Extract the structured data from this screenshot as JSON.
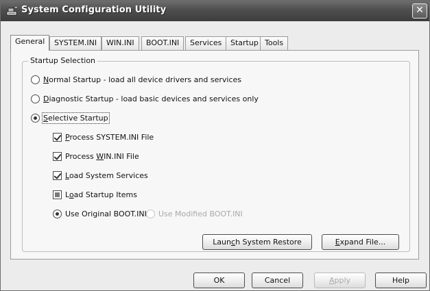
{
  "window": {
    "title": "System Configuration Utility",
    "close_glyph": "✕"
  },
  "tabs": [
    {
      "label": "General",
      "active": true
    },
    {
      "label": "SYSTEM.INI",
      "active": false
    },
    {
      "label": "WIN.INI",
      "active": false
    },
    {
      "label": "BOOT.INI",
      "active": false
    },
    {
      "label": "Services",
      "active": false
    },
    {
      "label": "Startup",
      "active": false
    },
    {
      "label": "Tools",
      "active": false
    }
  ],
  "startup_selection": {
    "legend": "Startup Selection",
    "normal": {
      "mnemonic": "N",
      "rest": "ormal Startup - load all device drivers and services",
      "checked": false
    },
    "diagnostic": {
      "mnemonic": "D",
      "rest": "iagnostic Startup - load basic devices and services only",
      "checked": false
    },
    "selective": {
      "mnemonic": "S",
      "rest": "elective Startup",
      "checked": true
    },
    "options": {
      "system_ini": {
        "pre": "",
        "mnemonic": "P",
        "rest": "rocess SYSTEM.INI File",
        "state": "checked"
      },
      "win_ini": {
        "pre": "Process ",
        "mnemonic": "W",
        "rest": "IN.INI File",
        "state": "checked"
      },
      "services": {
        "pre": "",
        "mnemonic": "L",
        "rest": "oad System Services",
        "state": "checked"
      },
      "startup_items": {
        "pre": "L",
        "mnemonic": "o",
        "rest": "ad Startup Items",
        "state": "mixed"
      }
    },
    "boot": {
      "original": {
        "label": "Use Original BOOT.INI",
        "checked": true
      },
      "modified": {
        "label": "Use Modified BOOT.INI",
        "checked": false,
        "disabled": true
      }
    }
  },
  "panel_buttons": {
    "restore": {
      "pre": "Laun",
      "mnemonic": "c",
      "rest": "h System Restore"
    },
    "expand": {
      "pre": "",
      "mnemonic": "E",
      "rest": "xpand File..."
    }
  },
  "footer": {
    "ok": "OK",
    "cancel": "Cancel",
    "apply_mnemonic": "A",
    "apply_rest": "pply",
    "help": "Help"
  }
}
